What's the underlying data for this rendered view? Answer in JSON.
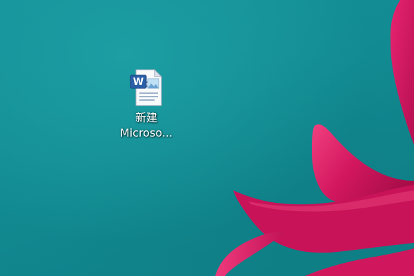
{
  "desktop": {
    "wallpaper": {
      "base_color": "#128a91",
      "petal_color": "#d51463",
      "petal_dark_color": "#b00f4f",
      "petal_light_color": "#ea3c7f"
    },
    "icons": [
      {
        "icon": "word-document-icon",
        "label_line1": "新建",
        "label_line2": "Microso..."
      }
    ]
  }
}
